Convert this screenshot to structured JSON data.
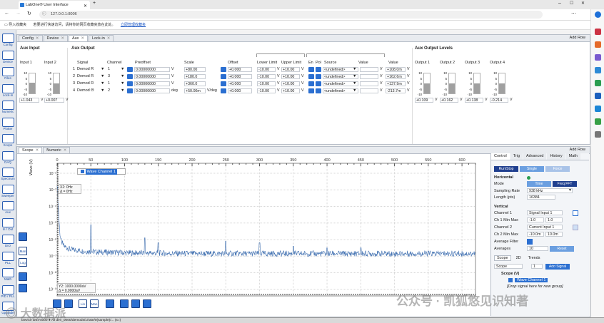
{
  "browser": {
    "tab_title": "LabOne® User Interface",
    "url": "127.0.0.1:8006",
    "favbar": {
      "import": "导入收藏夹",
      "hint": "若要进行快速访问，请将你的网页收藏夹放在此处。",
      "link": "立即管理收藏夹"
    }
  },
  "left_toolbar": [
    "Config",
    "Device",
    "Files",
    "Lock-in",
    "Numeric",
    "Plotter",
    "Scope",
    "DAQ",
    "Spectrum",
    "Sweeper",
    "Aux",
    "In / Out",
    "DIO",
    "PLL",
    "Math",
    "PID / PLL",
    "Upgrade"
  ],
  "aux_panel": {
    "tabs": [
      "Config",
      "Device",
      "Aux",
      "Lock-in"
    ],
    "add_row": "Add Row",
    "aux_input": {
      "title": "Aux Input",
      "labels": [
        "Input 1",
        "Input 2"
      ],
      "scale": [
        "10",
        "5",
        "0",
        "-5",
        "-10"
      ],
      "values": [
        "+1.043",
        "+0.007"
      ],
      "unit": "V",
      "levels": [
        0.55,
        0.5
      ]
    },
    "aux_output": {
      "title": "Aux Output",
      "headers": {
        "signal": "Signal",
        "channel": "Channel",
        "preoffset": "Preoffset",
        "scale": "Scale",
        "offset": "Offset",
        "lower": "Lower Limit",
        "upper": "Upper Limit",
        "en": "En",
        "pol": "Pol",
        "source": "Source",
        "value": "Value",
        "value2": "Value"
      },
      "rows": [
        {
          "num": "1",
          "signal": "Demod R",
          "channel": "1",
          "preoffset": "0.00000000",
          "pre_unit": "V",
          "scale": "+80.00",
          "scale_unit": "",
          "offset": "+0.000",
          "lower": "-10.00",
          "upper": "+10.00",
          "source": "<undefined>",
          "value": "+108.0m",
          "unit": "V"
        },
        {
          "num": "2",
          "signal": "Demod R",
          "channel": "3",
          "preoffset": "0.00000000",
          "pre_unit": "V",
          "scale": "+180.0",
          "scale_unit": "",
          "offset": "+0.000",
          "lower": "-10.00",
          "upper": "+10.00",
          "source": "<undefined>",
          "value": "+162.6m",
          "unit": "V"
        },
        {
          "num": "3",
          "signal": "Demod R",
          "channel": "1",
          "preoffset": "0.00000000",
          "pre_unit": "V",
          "scale": "+360.0",
          "scale_unit": "",
          "offset": "+0.000",
          "lower": "-10.00",
          "upper": "+10.00",
          "source": "<undefined>",
          "value": "+137.9m",
          "unit": "V"
        },
        {
          "num": "4",
          "signal": "Demod Θ",
          "channel": "2",
          "preoffset": "0.00000000",
          "pre_unit": "deg",
          "scale": "+50.00m",
          "scale_unit": "V/deg",
          "offset": "+0.000",
          "lower": "-10.00",
          "upper": "+10.00",
          "source": "<undefined>",
          "value": "-213.7m",
          "unit": "V"
        }
      ]
    },
    "aux_output_levels": {
      "title": "Aux Output Levels",
      "labels": [
        "Output 1",
        "Output 2",
        "Output 3",
        "Output 4"
      ],
      "scale": [
        "10",
        "5",
        "0",
        "-5",
        "-10"
      ],
      "values": [
        "+0.109",
        "+0.162",
        "+0.138",
        "-0.214"
      ],
      "unit": "V",
      "levels": [
        0.5,
        0.51,
        0.51,
        0.49
      ]
    }
  },
  "scope_panel": {
    "tabs": [
      "Scope",
      "Numeric"
    ],
    "add_row": "Add Row",
    "legend": "Wave Channel 1",
    "cursor_x": {
      "label": "X2: 0Hz",
      "delta": "Δ = 0Hz"
    },
    "cursor_y": {
      "label": "Y2: 1000.0000aV",
      "delta": "Δ = 0.0000aV"
    },
    "y_axis_label": "Wave (V)"
  },
  "chart_data": {
    "type": "line",
    "title": "",
    "xlabel": "",
    "ylabel": "Wave (V)",
    "x_ticks": [
      "0",
      "50",
      "100",
      "150",
      "200",
      "250",
      "300",
      "350",
      "400",
      "450",
      "500",
      "550",
      "600"
    ],
    "y_ticks": [
      "10⁻²",
      "10⁻³",
      "10⁻⁴",
      "10⁻⁵",
      "10⁻⁶",
      "10⁻⁷",
      "10⁻⁸",
      "10⁻⁹"
    ],
    "xlim": [
      0,
      620
    ],
    "y_log": true,
    "ylim_exp": [
      -9.4,
      -1.4
    ],
    "grid": true,
    "series": [
      {
        "name": "Wave Channel 1",
        "color": "#3f6fb0",
        "baseline_exp": -6.85,
        "points": [
          [
            0,
            -2.6
          ],
          [
            2,
            -4.2
          ],
          [
            4,
            -5.6
          ],
          [
            6,
            -6.1
          ],
          [
            10,
            -6.4
          ],
          [
            20,
            -6.6
          ],
          [
            40,
            -6.7
          ],
          [
            60,
            -6.75
          ],
          [
            100,
            -6.8
          ],
          [
            200,
            -6.85
          ],
          [
            400,
            -6.85
          ],
          [
            620,
            -6.85
          ]
        ],
        "peaks": [
          [
            50,
            -5.1
          ],
          [
            130,
            -5.9
          ],
          [
            150,
            -6.2
          ],
          [
            250,
            -6.1
          ],
          [
            300,
            -6.2
          ],
          [
            350,
            -6.4
          ],
          [
            400,
            -6.5
          ],
          [
            450,
            -6.5
          ]
        ]
      }
    ]
  },
  "control": {
    "tabs": [
      "Control",
      "Trig",
      "Advanced",
      "History",
      "Math"
    ],
    "run_stop": "Run/Stop",
    "single": "Single",
    "force": "Force",
    "horizontal": "Horizontal",
    "mode_label": "Mode",
    "mode_time": "Time",
    "mode_fft": "Freq FFT",
    "sampling_label": "Sampling Rate",
    "sampling_value": "938 kHz",
    "length_label": "Length (pts)",
    "length_value": "16384",
    "vertical": "Vertical",
    "ch1_label": "Channel 1",
    "ch1_value": "Signal Input 1",
    "ch1_minmax_label": "Ch 1 Min Max",
    "ch1_min": "-1.0",
    "ch1_max": "1.0",
    "ch2_label": "Channel 2",
    "ch2_value": "Current Input 1",
    "ch2_minmax_label": "Ch 2 Min Max",
    "ch2_min": "-10.0m",
    "ch2_max": "10.0m",
    "avg_filter_label": "Average Filter",
    "averages_label": "Averages",
    "averages_value": "10",
    "reset": "Reset",
    "sub_tabs": [
      "Scope",
      "2D",
      "Trends"
    ],
    "scope_select": "Scope",
    "scope_select_num": "1",
    "add_signal": "Add Signal",
    "tree_title": "Scope (V)",
    "tree_item": "Wave Channel 1",
    "drop_hint": "[Drop signal here for new group]"
  },
  "status": "Device DEV4000   ● All   dev_0000/demods/1/rate/0(sample)/... (x=)"
}
